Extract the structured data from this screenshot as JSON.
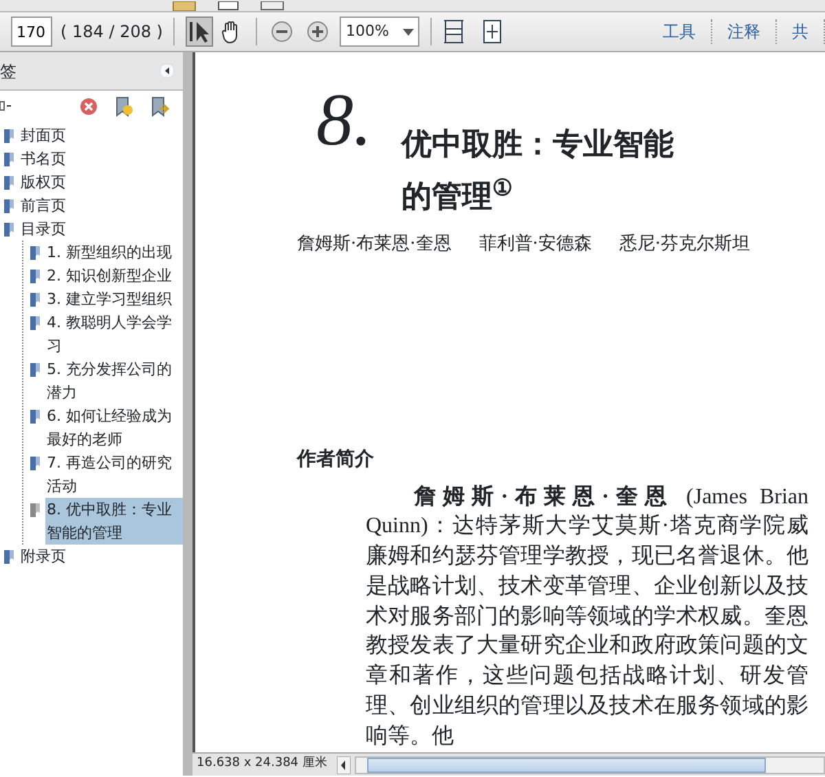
{
  "toolbar": {
    "page_number": "170",
    "page_count": "( 184 / 208 )",
    "zoom": "100%",
    "select_tool_selected": true,
    "links": [
      "工具",
      "注释",
      "共"
    ]
  },
  "bookmarks_panel": {
    "title": "签",
    "items": [
      {
        "label": "封面页",
        "selected": false
      },
      {
        "label": "书名页",
        "selected": false
      },
      {
        "label": "版权页",
        "selected": false
      },
      {
        "label": "前言页",
        "selected": false
      },
      {
        "label": "目录页",
        "selected": false,
        "expanded": true,
        "children": [
          {
            "label": "1. 新型组织的出现",
            "selected": false
          },
          {
            "label": "2. 知识创新型企业",
            "selected": false
          },
          {
            "label": "3. 建立学习型组织",
            "selected": false
          },
          {
            "label": "4. 教聪明人学会学习",
            "selected": false
          },
          {
            "label": "5. 充分发挥公司的潜力",
            "selected": false
          },
          {
            "label": "6. 如何让经验成为最好的老师",
            "selected": false
          },
          {
            "label": "7. 再造公司的研究活动",
            "selected": false
          },
          {
            "label": "8. 优中取胜：专业智能的管理",
            "selected": true
          }
        ]
      },
      {
        "label": "附录页",
        "selected": false
      }
    ]
  },
  "document": {
    "chapter_number": "8.",
    "title_lines": [
      "优中取胜：专业智能",
      "的管理$^{①}$"
    ],
    "authors": [
      "詹姆斯·布莱恩·奎恩",
      "菲利普·安德森",
      "悉尼·芬克尔斯坦"
    ],
    "section_heading": "作者简介",
    "paragraph": "**詹姆斯·布莱恩·奎恩** (James Brian Quinn)：达特茅斯大学艾莫斯·塔克商学院威廉姆和约瑟芬管理学教授，现已名誉退休。他是战略计划、技术变革管理、企业创新以及技术对服务部门的影响等领域的学术权威。奎恩教授发表了大量研究企业和政府政策问题的文章和著作，这些问题包括战略计划、研发管理、创业组织的管理以及技术在服务领域的影响等。他"
  },
  "status_bar": {
    "page_size": "16.638 x 24.384 厘米"
  }
}
